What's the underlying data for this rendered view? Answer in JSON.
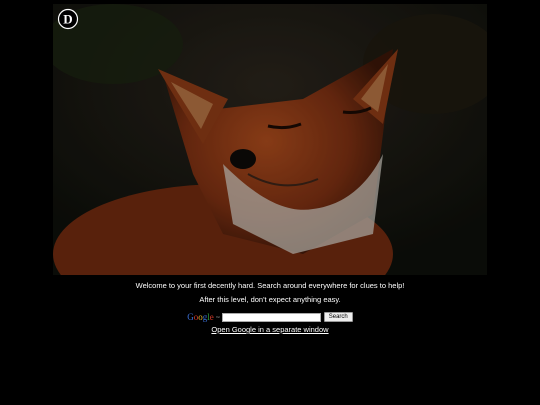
{
  "logo": {
    "text": "D",
    "icon": "circle-d-logo"
  },
  "photo": {
    "subject": "fox-photo"
  },
  "messages": {
    "welcome": "Welcome to your first decently hard. Search around everywhere for clues to help!",
    "warning": "After this level, don't expect anything easy."
  },
  "search": {
    "brand_g": "G",
    "brand_o1": "o",
    "brand_o2": "o",
    "brand_g2": "g",
    "brand_l": "l",
    "brand_e": "e",
    "brand_tm": "™",
    "placeholder": "",
    "value": "",
    "button_label": "Search"
  },
  "open_link": "Open Google in a separate window"
}
